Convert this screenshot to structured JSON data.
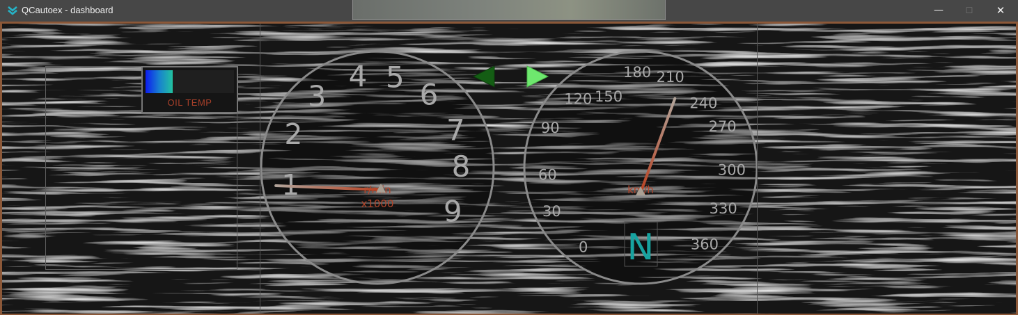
{
  "window": {
    "title": "QCautoex - dashboard",
    "minimize_glyph": "—",
    "maximize_glyph": "☐",
    "close_glyph": "✕"
  },
  "colors": {
    "titlebar": "#474747",
    "frame_border": "#8c5838",
    "dial_text": "#a9a9a9",
    "unit_text": "#b3452b",
    "gear_text": "#17a3a0",
    "arrow_left": "#145d14",
    "arrow_right": "#6ee86e"
  },
  "oil_temp": {
    "label": "OIL TEMP",
    "level": 0.31
  },
  "tachometer": {
    "labels": [
      "1",
      "2",
      "3",
      "4",
      "5",
      "6",
      "7",
      "8",
      "9"
    ],
    "unit_line1": "r/min",
    "unit_line2": "x1000",
    "value": 1.1
  },
  "speedometer": {
    "labels": [
      "0",
      "30",
      "60",
      "90",
      "120",
      "150",
      "180",
      "210",
      "240",
      "270",
      "300",
      "330",
      "360"
    ],
    "unit": "km/h",
    "value": 210
  },
  "gear": "N",
  "indicators": {
    "left_turn": "left-turn-arrow-icon",
    "right_turn": "right-turn-arrow-icon"
  }
}
